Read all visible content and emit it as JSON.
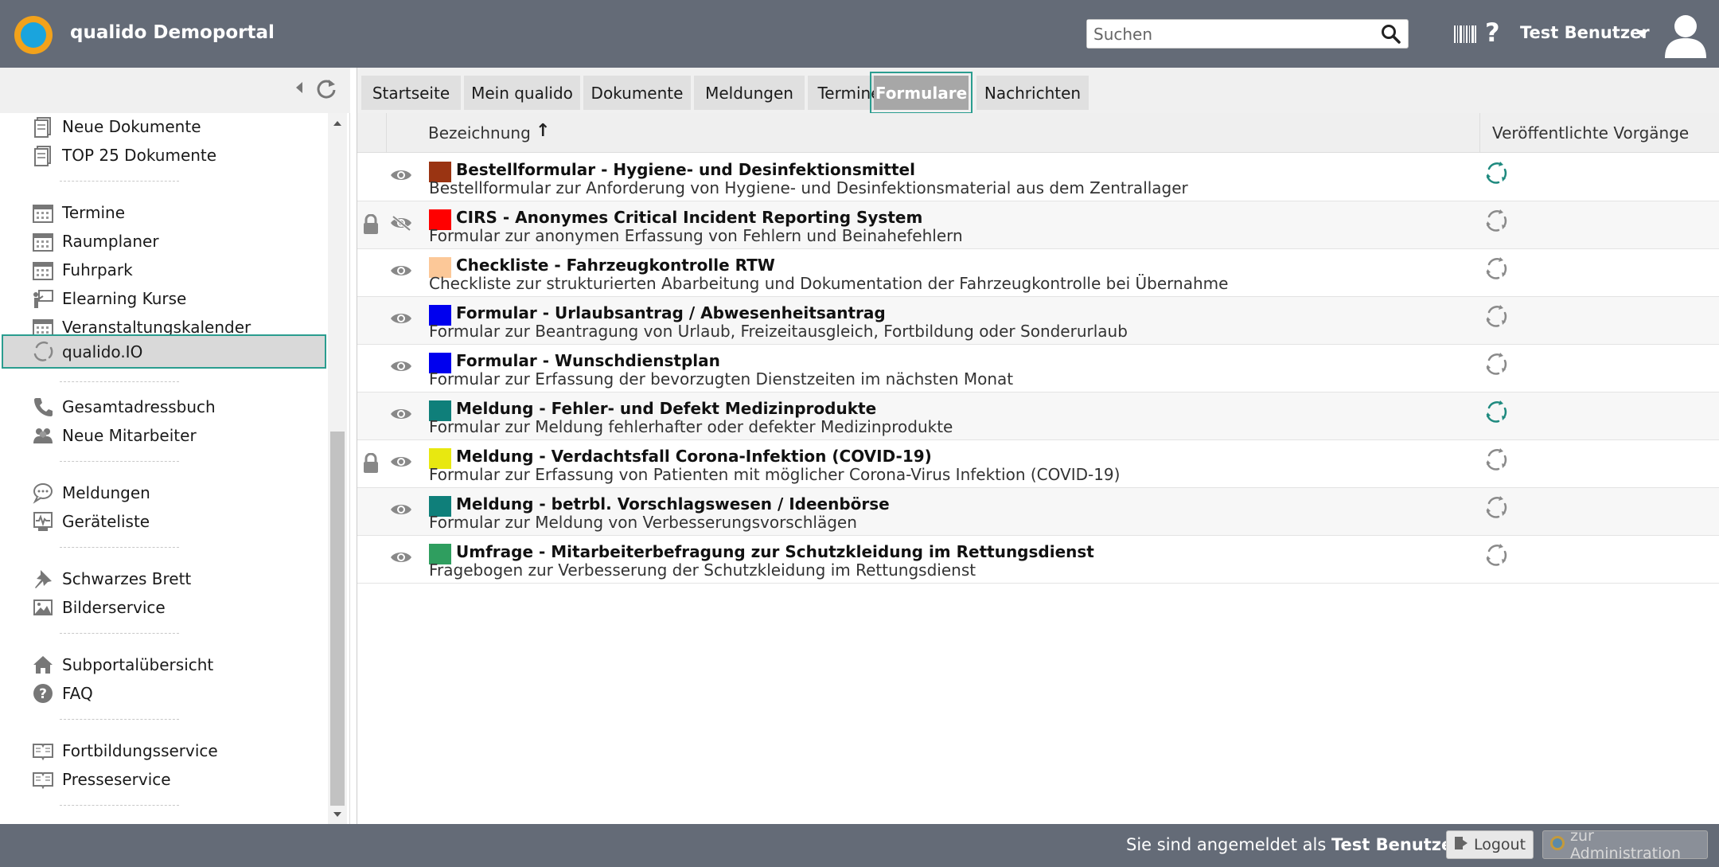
{
  "header": {
    "app_title": "qualido Demoportal",
    "search_placeholder": "Suchen",
    "help_label": "?",
    "user_name": "Test Benutzer"
  },
  "sidebar": {
    "items": [
      {
        "label": "Neue Dokumente",
        "icon": "documents-icon"
      },
      {
        "label": "TOP 25 Dokumente",
        "icon": "documents-icon"
      },
      {
        "label": "Termine",
        "icon": "calendar-icon"
      },
      {
        "label": "Raumplaner",
        "icon": "calendar-icon"
      },
      {
        "label": "Fuhrpark",
        "icon": "calendar-icon"
      },
      {
        "label": "Elearning Kurse",
        "icon": "presentation-icon"
      },
      {
        "label": "Veranstaltungskalender",
        "icon": "calendar-icon"
      },
      {
        "label": "qualido.IO",
        "icon": "process-icon",
        "active": true
      },
      {
        "label": "Gesamtadressbuch",
        "icon": "phone-icon"
      },
      {
        "label": "Neue Mitarbeiter",
        "icon": "users-icon"
      },
      {
        "label": "Meldungen",
        "icon": "chat-icon"
      },
      {
        "label": "Geräteliste",
        "icon": "device-icon"
      },
      {
        "label": "Schwarzes Brett",
        "icon": "pin-icon"
      },
      {
        "label": "Bilderservice",
        "icon": "image-icon"
      },
      {
        "label": "Subportalübersicht",
        "icon": "home-icon"
      },
      {
        "label": "FAQ",
        "icon": "question-icon"
      },
      {
        "label": "Fortbildungsservice",
        "icon": "book-icon"
      },
      {
        "label": "Presseservice",
        "icon": "book-icon"
      }
    ]
  },
  "tabs": [
    {
      "label": "Startseite"
    },
    {
      "label": "Mein qualido"
    },
    {
      "label": "Dokumente"
    },
    {
      "label": "Meldungen"
    },
    {
      "label": "Termine"
    },
    {
      "label": "Formulare",
      "active": true
    },
    {
      "label": "Nachrichten"
    }
  ],
  "table": {
    "col_bezeichnung": "Bezeichnung",
    "sort_indicator": "↑",
    "col_vorgaenge": "Veröffentlichte Vorgänge",
    "rows": [
      {
        "title": "Bestellformular - Hygiene- und Desinfektionsmittel",
        "desc": "Bestellformular zur Anforderung von Hygiene- und Desinfektionsmaterial aus dem Zentrallager",
        "color": "#9a3412",
        "locked": false,
        "visible": true,
        "process_active": true
      },
      {
        "title": "CIRS - Anonymes Critical Incident Reporting System",
        "desc": "Formular zur anonymen Erfassung von Fehlern und Beinahefehlern",
        "color": "#ff0000",
        "locked": true,
        "visible": false,
        "process_active": false
      },
      {
        "title": "Checkliste - Fahrzeugkontrolle RTW",
        "desc": "Checkliste zur strukturierten Abarbeitung und Dokumentation der Fahrzeugkontrolle bei Übernahme",
        "color": "#fcc898",
        "locked": false,
        "visible": true,
        "process_active": false
      },
      {
        "title": "Formular - Urlaubsantrag / Abwesenheitsantrag",
        "desc": "Formular zur Beantragung von Urlaub, Freizeitausgleich, Fortbildung oder Sonderurlaub",
        "color": "#0000ee",
        "locked": false,
        "visible": true,
        "process_active": false
      },
      {
        "title": "Formular - Wunschdienstplan",
        "desc": "Formular zur Erfassung der bevorzugten Dienstzeiten im nächsten Monat",
        "color": "#0000ee",
        "locked": false,
        "visible": true,
        "process_active": false
      },
      {
        "title": "Meldung - Fehler- und Defekt Medizinprodukte",
        "desc": "Formular zur Meldung fehlerhafter oder defekter Medizinprodukte",
        "color": "#0f7f7a",
        "locked": false,
        "visible": true,
        "process_active": true
      },
      {
        "title": "Meldung - Verdachtsfall Corona-Infektion (COVID-19)",
        "desc": "Formular zur Erfassung von Patienten mit möglicher Corona-Virus Infektion (COVID-19)",
        "color": "#e8e810",
        "locked": true,
        "visible": true,
        "process_active": false
      },
      {
        "title": "Meldung - betrbl. Vorschlagswesen / Ideenbörse",
        "desc": "Formular zur Meldung von Verbesserungsvorschlägen",
        "color": "#0f7f7a",
        "locked": false,
        "visible": true,
        "process_active": false
      },
      {
        "title": "Umfrage - Mitarbeiterbefragung zur Schutzkleidung im Rettungsdienst",
        "desc": "Fragebogen zur Verbesserung der Schutzkleidung im Rettungsdienst",
        "color": "#2f9e5f",
        "locked": false,
        "visible": true,
        "process_active": false
      }
    ]
  },
  "footer": {
    "logged_in_prefix": "Sie sind angemeldet als",
    "logged_in_user": "Test Benutzer",
    "logout_label": "Logout",
    "admin_label": "zur Administration"
  },
  "colors": {
    "header_bg": "#646b77",
    "accent": "#2a9d8f",
    "process_active": "#1f8a7f",
    "process_inactive": "#8a8a8a"
  }
}
